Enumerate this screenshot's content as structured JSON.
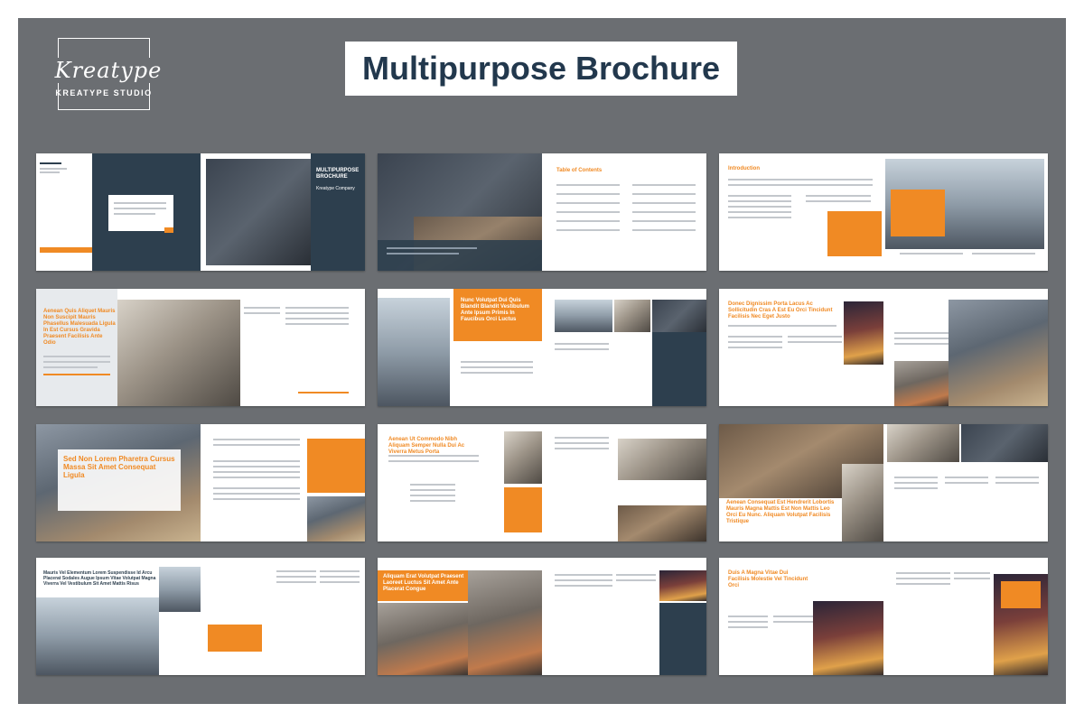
{
  "brand": {
    "script_name": "Kreatype",
    "studio_name": "KREATYPE STUDIO"
  },
  "title": "Multipurpose Brochure",
  "spreads": [
    {
      "heading": "MULTIPURPOSE BROCHURE",
      "subheading": "Kreatype Company"
    },
    {
      "heading": "Table of Contents"
    },
    {
      "heading": "Introduction"
    },
    {
      "heading": "Aenean Quis Aliquet Mauris Non Suscipit Mauris Phasellus Malesuada Ligula In Est Cursus Gravida Praesent Facilisis Ante Odio"
    },
    {
      "heading": "Nunc Volutpat Dui Quis Blandit Blandit Vestibulum Ante Ipsum Primis In Faucibus Orci Luctus"
    },
    {
      "heading": "Donec Dignissim Porta Lacus Ac Sollicitudin Cras A Est Eu Orci Tincidunt Facilisis Nec Eget Justo"
    },
    {
      "heading": "Sed Non Lorem Pharetra Cursus Massa Sit Amet Consequat Ligula"
    },
    {
      "heading": "Aenean Ut Commodo Nibh Aliquam Semper Nulla Dui Ac Viverra Metus Porta"
    },
    {
      "heading": "Aenean Consequat Est Hendrerit Lobortis Mauris Magna Mattis Est Non Mattis Leo Orci Eu Nunc. Aliquam Volutpat Facilisis Tristique"
    },
    {
      "heading": "Mauris Vel Elementum Lorem Suspendisse Id Arcu Placerat Sodales Augue Ipsum Vitae Volutpat Magna Viverra Vel Vestibulum Sit Amet Mattis Risus"
    },
    {
      "heading": "Aliquam Erat Volutpat Praesent Laoreet Luctus Sit Amet Ante Placerat Congue"
    },
    {
      "heading": "Duis A Magna Vitae Dui Facilisis Molestie Vel Tincidunt Orci"
    }
  ]
}
